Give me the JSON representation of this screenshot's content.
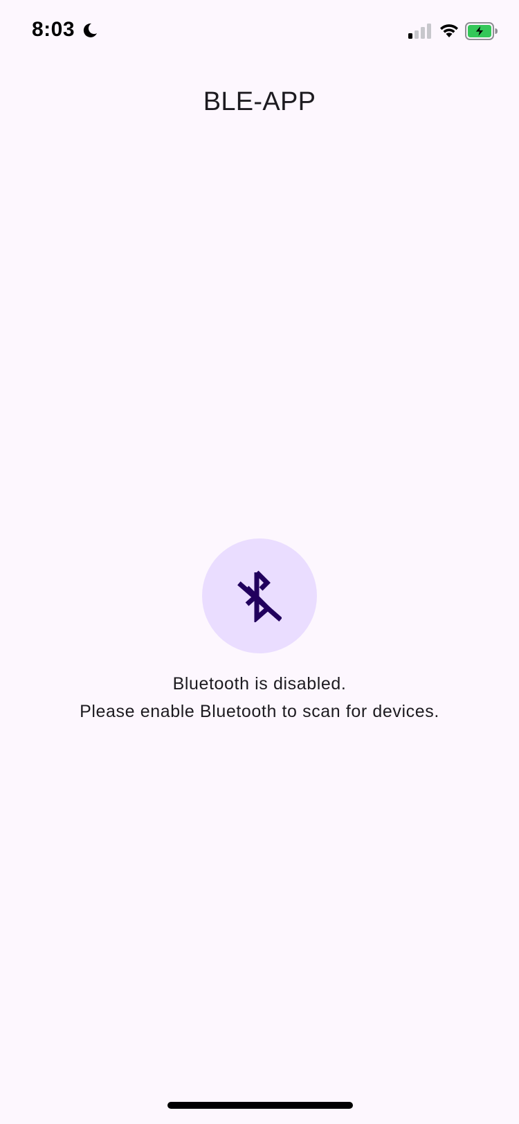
{
  "status_bar": {
    "time": "8:03",
    "icons": [
      "moon-icon",
      "cellular-signal-icon",
      "wifi-icon",
      "battery-charging-icon"
    ]
  },
  "app_bar": {
    "title": "BLE-APP"
  },
  "bluetooth_state": {
    "icon": "bluetooth-disabled-icon",
    "line1": "Bluetooth is disabled.",
    "line2": "Please enable Bluetooth to scan for devices."
  },
  "colors": {
    "background": "#fdf7fe",
    "icon_circle": "#eaddff",
    "icon_glyph": "#21005d",
    "battery_fill": "#34c759"
  }
}
